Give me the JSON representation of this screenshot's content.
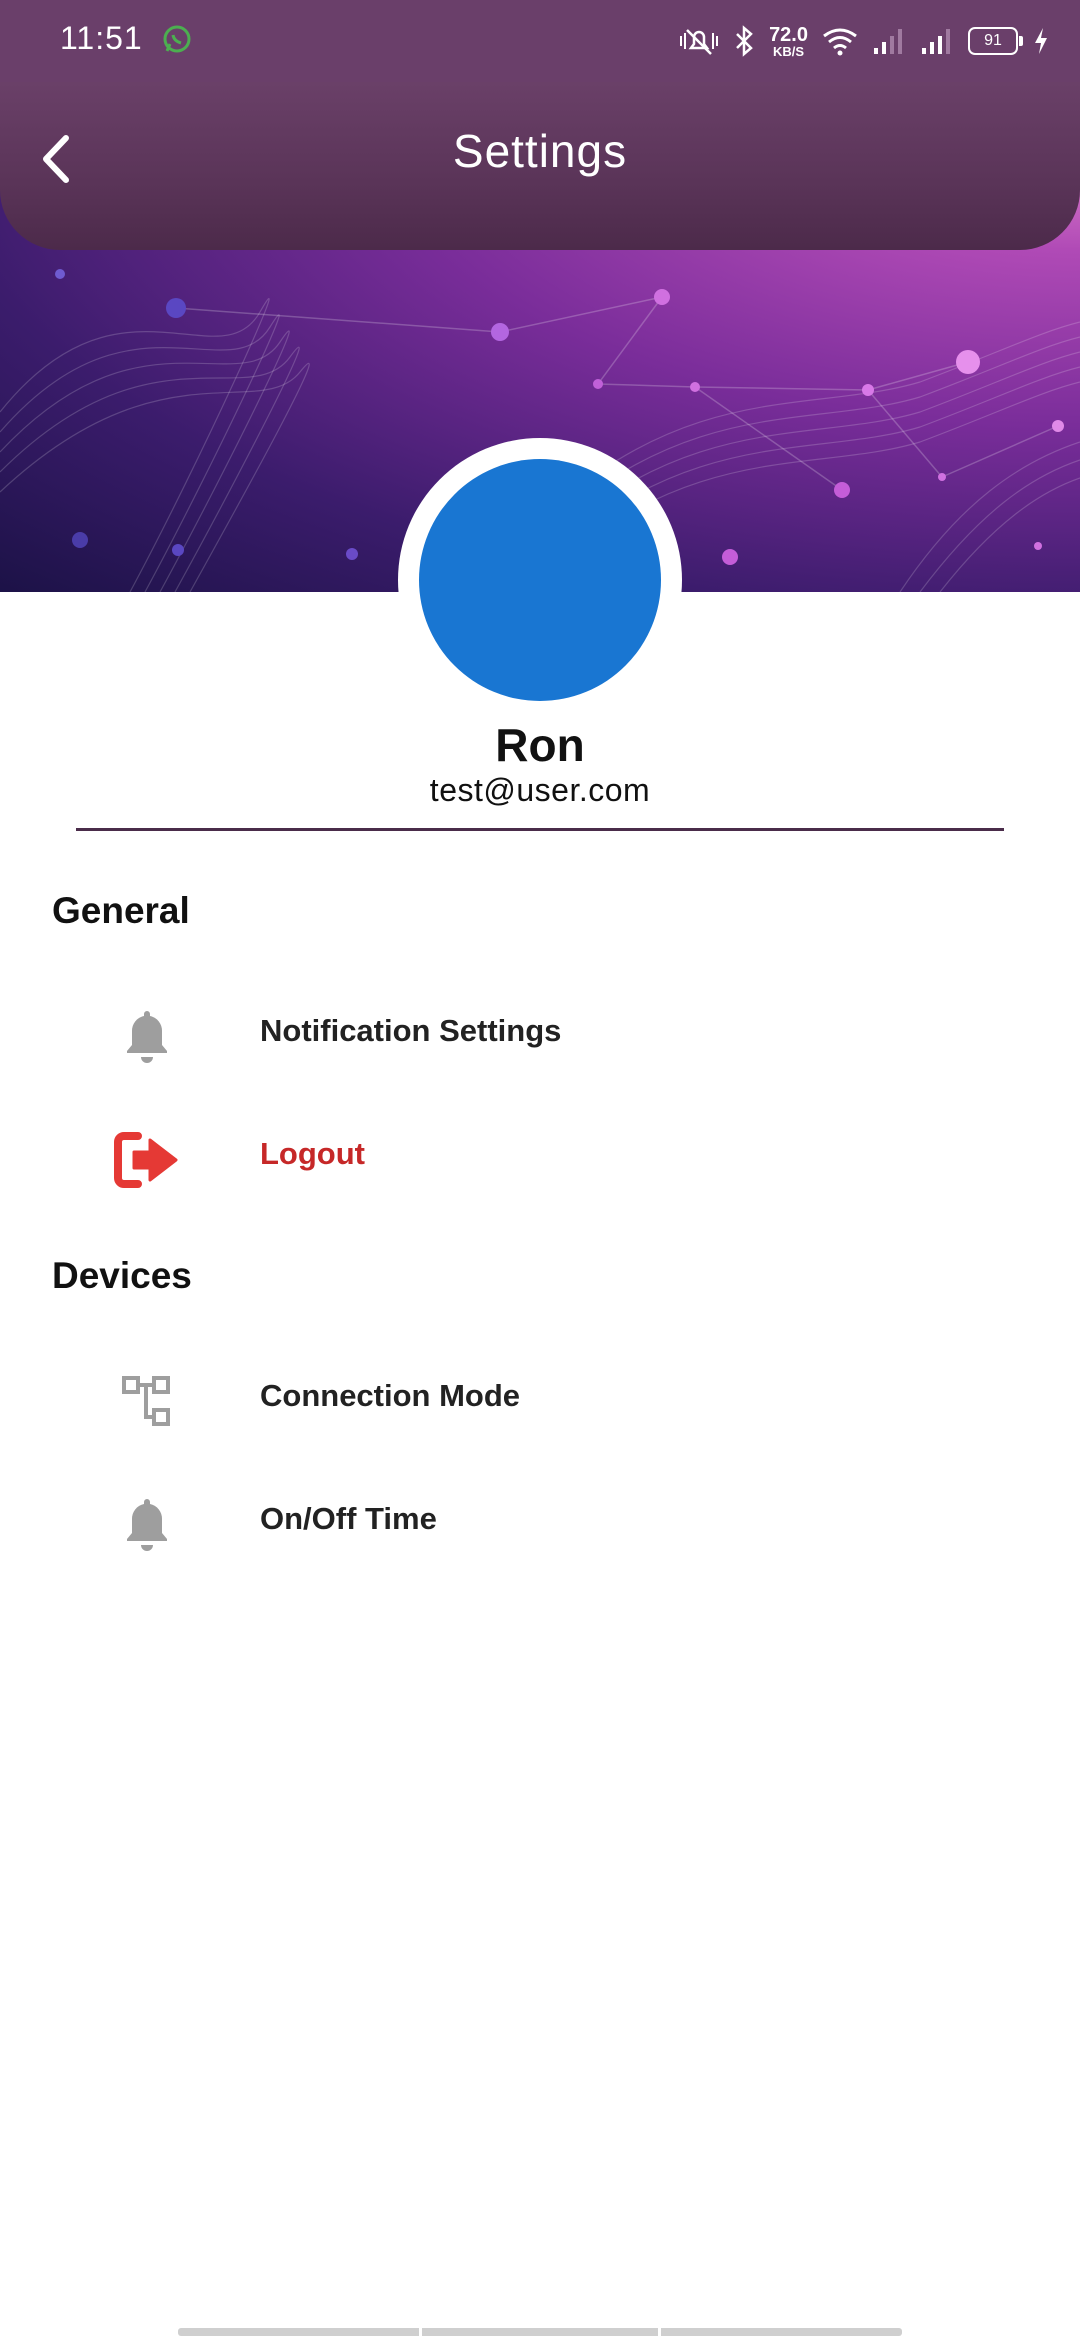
{
  "status_bar": {
    "time": "11:51",
    "speed_value": "72.0",
    "speed_unit": "KB/S",
    "battery": "91",
    "icons": [
      "whatsapp-icon",
      "mute-icon",
      "bluetooth-icon",
      "wifi-icon",
      "signal-icon",
      "signal-icon",
      "battery-icon",
      "charging-icon"
    ]
  },
  "header": {
    "title": "Settings",
    "back_icon": "chevron-left-icon"
  },
  "profile": {
    "name": "Ron",
    "email": "test@user.com",
    "avatar_color": "#1976d2"
  },
  "sections": [
    {
      "title": "General",
      "items": [
        {
          "label": "Notification Settings",
          "icon": "bell-icon"
        },
        {
          "label": "Logout",
          "icon": "logout-icon",
          "color": "#c62828"
        }
      ]
    },
    {
      "title": "Devices",
      "items": [
        {
          "label": "Connection Mode",
          "icon": "network-icon"
        },
        {
          "label": "On/Off Time",
          "icon": "bell-icon"
        }
      ]
    }
  ],
  "colors": {
    "appbar": "#5a3458",
    "accent_danger": "#c62828",
    "icon_gray": "#9e9e9e"
  }
}
